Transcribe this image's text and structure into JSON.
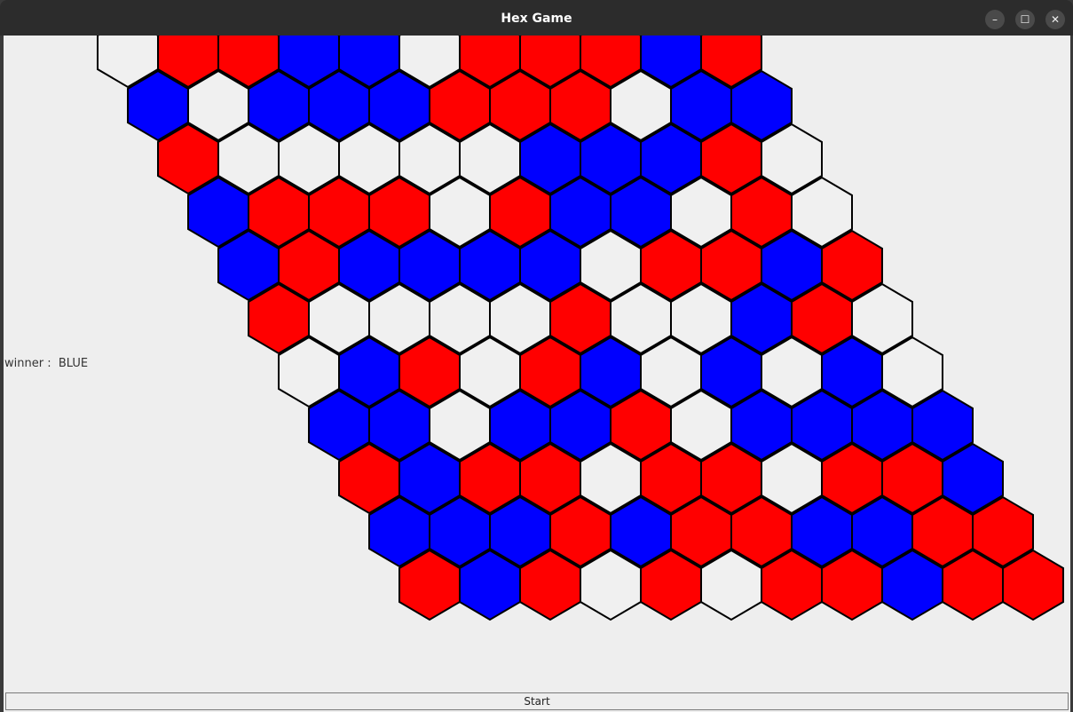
{
  "window": {
    "title": "Hex Game",
    "controls": {
      "minimize": "–",
      "maximize": "☐",
      "close": "✕"
    }
  },
  "status": {
    "winner_label": "winner :  BLUE"
  },
  "controls": {
    "start_label": "Start"
  },
  "colors": {
    "R": "#ff0000",
    "B": "#0000ff",
    "E": "#f0f0f0",
    "outline": "#000000",
    "background": "#eeeeee"
  },
  "board": {
    "size": 11,
    "legend": {
      "R": "red",
      "B": "blue",
      "E": "empty"
    },
    "rows": [
      [
        "E",
        "R",
        "R",
        "B",
        "B",
        "E",
        "R",
        "R",
        "R",
        "B",
        "R"
      ],
      [
        "B",
        "E",
        "B",
        "B",
        "B",
        "R",
        "R",
        "R",
        "E",
        "B",
        "B"
      ],
      [
        "R",
        "E",
        "E",
        "E",
        "E",
        "E",
        "B",
        "B",
        "B",
        "R",
        "E"
      ],
      [
        "B",
        "R",
        "R",
        "R",
        "E",
        "R",
        "B",
        "B",
        "E",
        "R",
        "E"
      ],
      [
        "B",
        "R",
        "B",
        "B",
        "B",
        "B",
        "E",
        "R",
        "R",
        "B",
        "R"
      ],
      [
        "R",
        "E",
        "E",
        "E",
        "E",
        "R",
        "E",
        "E",
        "B",
        "R",
        "E"
      ],
      [
        "E",
        "B",
        "R",
        "E",
        "R",
        "B",
        "E",
        "B",
        "E",
        "B",
        "E"
      ],
      [
        "B",
        "B",
        "E",
        "B",
        "B",
        "R",
        "E",
        "B",
        "B",
        "B",
        "B"
      ],
      [
        "R",
        "B",
        "R",
        "R",
        "E",
        "R",
        "R",
        "E",
        "R",
        "R",
        "B"
      ],
      [
        "B",
        "B",
        "B",
        "R",
        "B",
        "R",
        "R",
        "B",
        "B",
        "R",
        "R"
      ],
      [
        "R",
        "B",
        "R",
        "E",
        "R",
        "E",
        "R",
        "R",
        "B",
        "R",
        "R"
      ]
    ]
  }
}
